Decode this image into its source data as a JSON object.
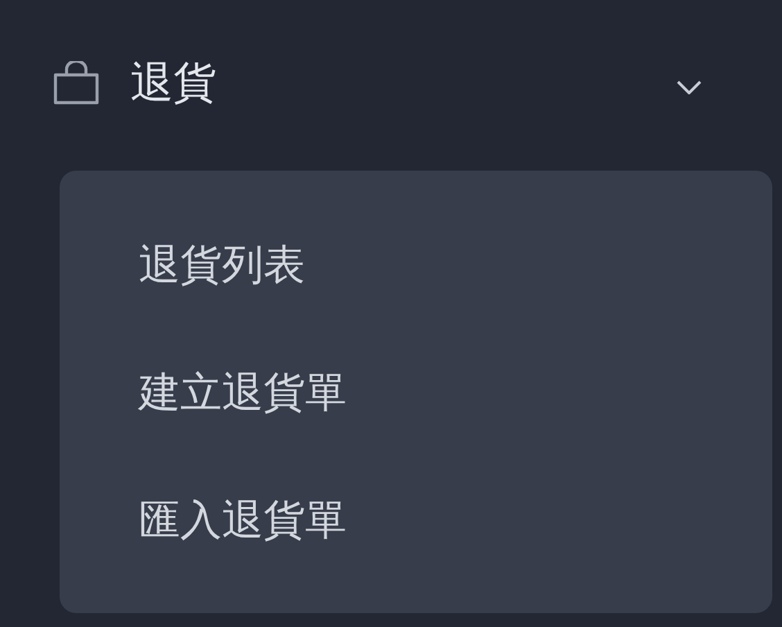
{
  "menu": {
    "label": "退貨",
    "expanded": true,
    "items": [
      {
        "label": "退貨列表"
      },
      {
        "label": "建立退貨單"
      },
      {
        "label": "匯入退貨單"
      }
    ]
  }
}
